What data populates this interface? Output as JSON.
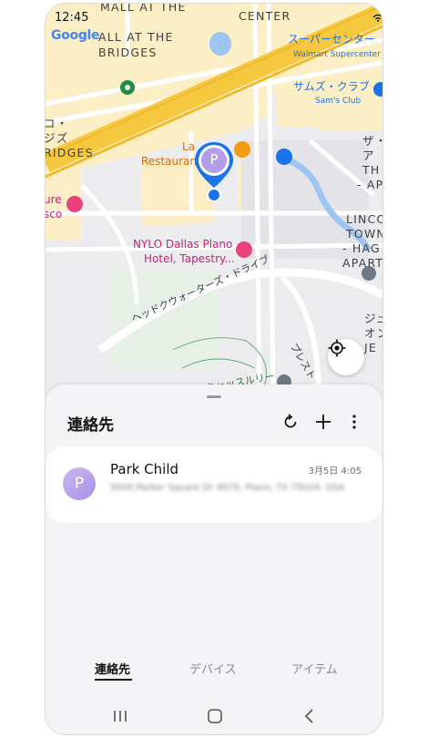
{
  "status_bar": {
    "time": "12:45",
    "icons": "Wi-Fi signal battery"
  },
  "map": {
    "provider_logo": "Google",
    "labels": {
      "mall_top": "MALL AT THE",
      "center": "CENTER",
      "mall": "ALL AT THE",
      "bridges": "BRIDGES",
      "supercenter_jp": "スーパーセンター",
      "walmart": "Walmart Supercenter",
      "sams_jp": "サムズ・クラブ",
      "sams": "Sam's Club",
      "left_jp1": "コ・",
      "left_jp2": "ジズ",
      "left_bridges": "RIDGES",
      "restaurant_la": "La",
      "restaurant": "Restaurant",
      "right_za": "ザ・",
      "right_a": "ア",
      "right_th": "TH",
      "right_ap": "- AP",
      "hotel_ure": "ure",
      "hotel_sco": "sco",
      "nylo1": "NYLO Dallas Plano",
      "nylo2": "Hotel, Tapestry...",
      "linco1": "LINCO",
      "linco2": "TOWNE",
      "linco3": "- HAG",
      "linco4": "APART",
      "road_diag": "ヘッドクウォーターズ・ドライブ",
      "road_right": "プレスト",
      "right_je1": "ジュ",
      "right_je2": "オン",
      "right_je3": "JE",
      "park": "キャッスルリー"
    },
    "pin_letter": "P"
  },
  "sheet": {
    "title": "連絡先",
    "tools": [
      "refresh-icon",
      "plus-icon",
      "more-vert-icon"
    ],
    "contact": {
      "avatar_letter": "P",
      "name": "Park Child",
      "address": "5000 Parker Square Dr 4075, Plano, TX 75024, USA",
      "timestamp": "3月5日 4:05"
    },
    "tabs": [
      {
        "label": "連絡先",
        "active": true
      },
      {
        "label": "デバイス",
        "active": false
      },
      {
        "label": "アイテム",
        "active": false
      }
    ]
  },
  "nav": [
    "recents-icon",
    "home-icon",
    "back-icon"
  ],
  "colors": {
    "accent": "#1a73e8",
    "avatar": "#a98fe6",
    "highway": "#f6c83f",
    "urban": "#fcefc6"
  }
}
